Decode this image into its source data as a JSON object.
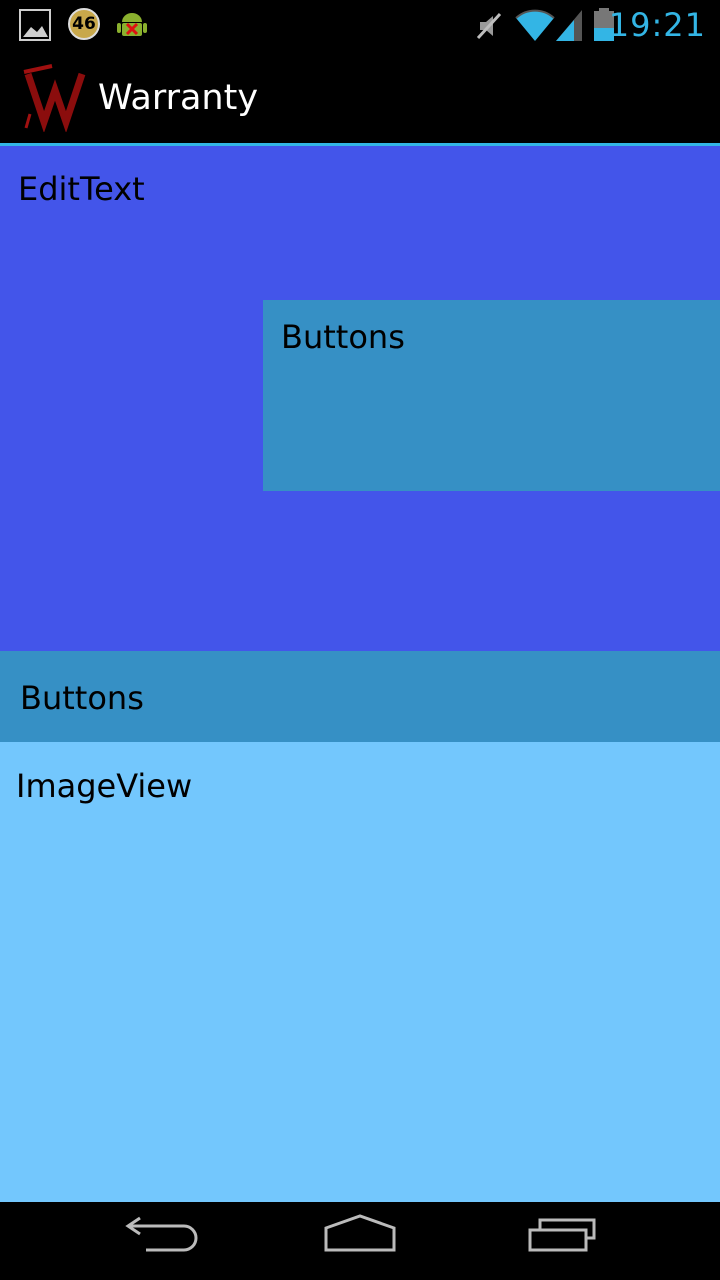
{
  "status_bar": {
    "time": "19:21",
    "notification_count": "46",
    "icons": [
      "gallery-icon",
      "notification-46-icon",
      "android-debug-icon",
      "mute-icon",
      "wifi-icon",
      "signal-icon",
      "battery-icon"
    ]
  },
  "action_bar": {
    "title": "Warranty",
    "logo_letter": "W"
  },
  "content": {
    "edit_text_label": "EditText",
    "buttons_top_label": "Buttons",
    "buttons_bottom_label": "Buttons",
    "image_view_label": "ImageView"
  },
  "nav_bar": {
    "icons": [
      "back-icon",
      "home-icon",
      "recent-apps-icon"
    ]
  },
  "colors": {
    "edit_block": "#4355ea",
    "buttons_block": "#3690c5",
    "image_block": "#73c7fd",
    "accent": "#33b5e5"
  }
}
